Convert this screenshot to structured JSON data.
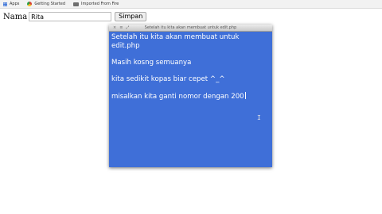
{
  "bookmarks_bar": {
    "items": [
      {
        "label": "Apps",
        "icon": "apps-icon"
      },
      {
        "label": "Getting Started",
        "icon": "chrome-icon"
      },
      {
        "label": "Imported From Fire",
        "icon": "folder-icon"
      }
    ]
  },
  "form": {
    "nama_label": "Nama",
    "nama_value": "Rita",
    "simpan_label": "Simpan"
  },
  "note_window": {
    "title": "Setelah itu kita akan membuat untuk edit.php",
    "title_buttons": [
      "×",
      "≡",
      "⤢"
    ],
    "background_color": "#3f6fd8",
    "lines": [
      "Setelah itu kita akan membuat untuk edit.php",
      "Masih kosng semuanya",
      "kita sedikit kopas biar cepet ^_^",
      "misalkan kita ganti nomor dengan 200"
    ]
  }
}
